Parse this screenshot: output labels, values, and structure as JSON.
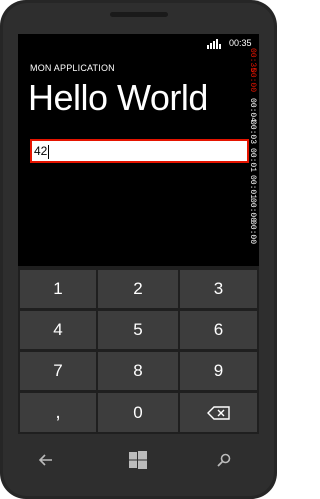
{
  "status": {
    "time": "00:35",
    "signal_icon": "signal-icon"
  },
  "app": {
    "name": "MON APPLICATION",
    "title": "Hello World"
  },
  "input": {
    "value": "42"
  },
  "counter_lines": [
    "00:35",
    "00:00",
    "00:04",
    "00:03",
    "00:01",
    "00:01",
    "00:00",
    "00:00"
  ],
  "keypad": {
    "keys": [
      "1",
      "2",
      "3",
      "4",
      "5",
      "6",
      "7",
      "8",
      "9",
      ",",
      "0"
    ],
    "backspace_icon": "backspace-icon"
  },
  "nav": {
    "back_icon": "back-arrow-icon",
    "home_icon": "windows-logo-icon",
    "search_icon": "search-icon"
  },
  "colors": {
    "accent": "#e51400",
    "key_bg": "#3d3d3d",
    "screen_bg": "#000000"
  }
}
